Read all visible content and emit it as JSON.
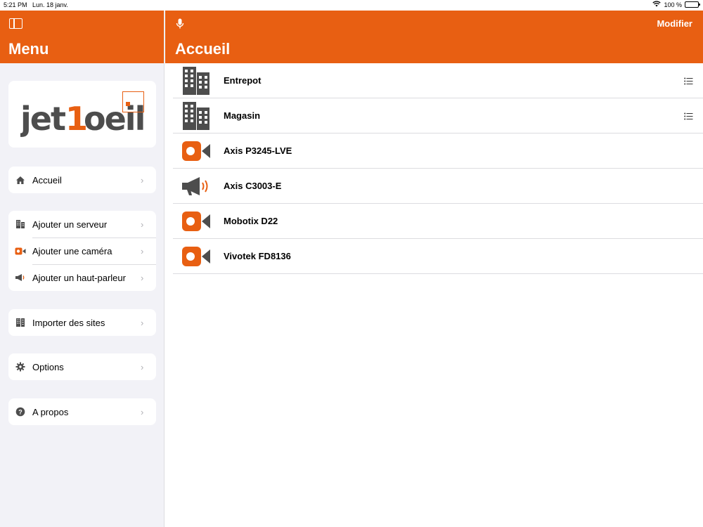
{
  "status_bar": {
    "time": "5:21 PM",
    "date": "Lun. 18 janv.",
    "battery": "100 %"
  },
  "sidebar": {
    "title": "Menu",
    "logo_text": "jet1oeil",
    "groups": [
      [
        {
          "label": "Accueil",
          "icon": "house-icon"
        }
      ],
      [
        {
          "label": "Ajouter un serveur",
          "icon": "building-icon"
        },
        {
          "label": "Ajouter une caméra",
          "icon": "camera-icon"
        },
        {
          "label": "Ajouter un haut-parleur",
          "icon": "megaphone-icon"
        }
      ],
      [
        {
          "label": "Importer des sites",
          "icon": "import-icon"
        }
      ],
      [
        {
          "label": "Options",
          "icon": "gear-icon"
        }
      ],
      [
        {
          "label": "A propos",
          "icon": "question-icon"
        }
      ]
    ]
  },
  "main": {
    "title": "Accueil",
    "edit_label": "Modifier",
    "items": [
      {
        "name": "Entrepot",
        "type": "site",
        "has_detail": true
      },
      {
        "name": "Magasin",
        "type": "site",
        "has_detail": true
      },
      {
        "name": "Axis P3245-LVE",
        "type": "camera",
        "has_detail": false
      },
      {
        "name": "Axis C3003-E",
        "type": "speaker",
        "has_detail": false
      },
      {
        "name": "Mobotix D22",
        "type": "camera",
        "has_detail": false
      },
      {
        "name": "Vivotek FD8136",
        "type": "camera",
        "has_detail": false
      }
    ]
  },
  "colors": {
    "accent": "#e85f12",
    "sidebar_bg": "#f2f2f7",
    "icon_gray": "#4d4d4d"
  }
}
